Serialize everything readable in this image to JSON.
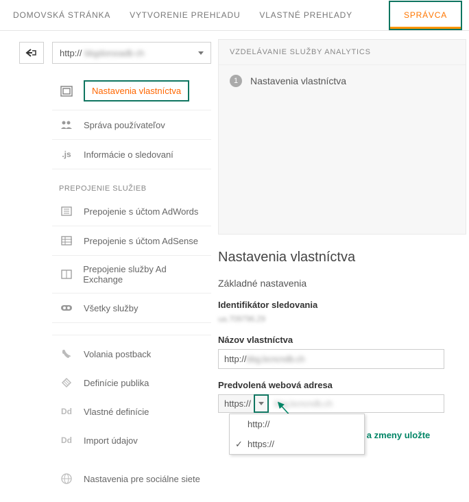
{
  "topnav": {
    "home": "DOMOVSKÁ STRÁNKA",
    "reporting": "VYTVORENIE PREHĽADU",
    "custom": "VLASTNÉ PREHĽADY",
    "admin": "SPRÁVCA"
  },
  "property_select": {
    "prefix": "http://",
    "blurred": "bbgdorooadb ch"
  },
  "sidebar": {
    "property_settings": "Nastavenia vlastníctva",
    "user_management": "Správa používateľov",
    "tracking_info": "Informácie o sledovaní",
    "section_linking": "PREPOJENIE SLUŽIEB",
    "adwords": "Prepojenie s účtom AdWords",
    "adsense": "Prepojenie s účtom AdSense",
    "adexchange": "Prepojenie služby Ad Exchange",
    "all_products": "Všetky služby",
    "postbacks": "Volania postback",
    "audience_def": "Definície publika",
    "custom_def": "Vlastné definície",
    "data_import": "Import údajov",
    "social": "Nastavenia pre sociálne siete"
  },
  "breadcrumb": {
    "head": "VZDELÁVANIE SLUŽBY ANALYTICS",
    "step1_num": "1",
    "step1": "Nastavenia vlastníctva"
  },
  "panel": {
    "title": "Nastavenia vlastníctva",
    "basic": "Základné nastavenia",
    "tracking_id_label": "Identifikátor sledovania",
    "tracking_id_value": "ua.709796.29",
    "name_label": "Názov vlastníctva",
    "name_prefix": "http://",
    "name_blurred": "bbg.bcncndb.ch",
    "url_label": "Predvolená webová adresa",
    "url_scheme": "https://",
    "url_blurred": "bbg.bcncndb.ch",
    "dropdown": {
      "opt_http": "http://",
      "opt_https": "https://"
    },
    "annotation": "vyberte https:// a zmeny uložte"
  },
  "icons": {
    "dd_label": "Dd",
    "js_label": ".js"
  }
}
